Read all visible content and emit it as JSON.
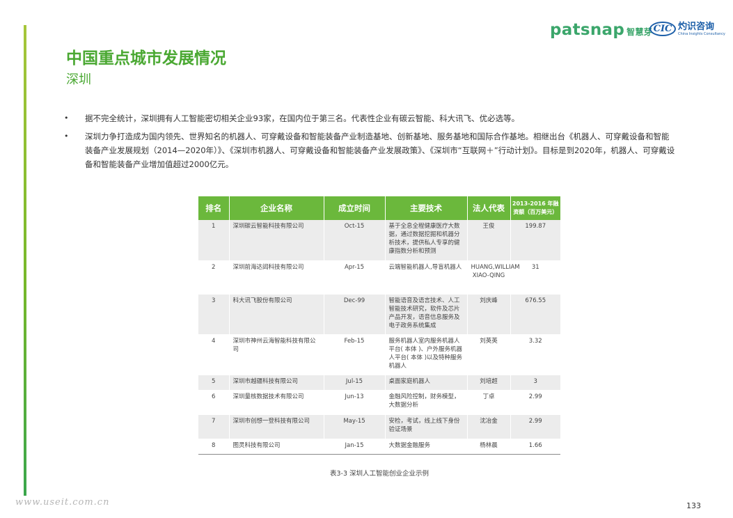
{
  "logos": {
    "patsnap": "patsnap",
    "patsnap_cn": "智慧芽",
    "cic_mark": "CIC",
    "cic_cn": "灼识咨询",
    "cic_en": "China Insights Consultancy"
  },
  "title": "中国重点城市发展情况",
  "subtitle": "深圳",
  "bullets": [
    "据不完全统计，深圳拥有人工智能密切相关企业93家，在国内位于第三名。代表性企业有碳云智能、科大讯飞、优必选等。",
    "深圳力争打造成为国内领先、世界知名的机器人、可穿戴设备和智能装备产业制造基地、创新基地、服务基地和国际合作基地。相继出台《机器人、可穿戴设备和智能装备产业发展规划（2014—2020年）》、《深圳市机器人、可穿戴设备和智能装备产业发展政策》、《深圳市“互联网＋”行动计划》。目标是到2020年，机器人、可穿戴设备和智能装备产业增加值超过2000亿元。"
  ],
  "table": {
    "headers": [
      "排名",
      "企业名称",
      "成立时间",
      "主要技术",
      "法人代表",
      "2013-2016 年融资额（百万美元）"
    ],
    "rows": [
      [
        "1",
        "深圳碳云智能科技有限公司",
        "Oct-15",
        "基于全息全程健康医疗大数据，通过数据挖掘和机器分析技术，提供私人专享的健康指数分析和预测",
        "王俊",
        "199.87"
      ],
      [
        "2",
        "深圳前海达闼科技有限公司",
        "Apr-15",
        "云端智能机器人,导盲机器人",
        "HUANG,WILLIAM XIAO-QING",
        "31"
      ],
      [
        "3",
        "科大讯飞股份有限公司",
        "Dec-99",
        "智能语音及语言技术、人工智能技术研究，软件及芯片产品开发，语音信息服务及电子政务系统集成",
        "刘庆峰",
        "676.55"
      ],
      [
        "4",
        "深圳市神州云海智能科技有限公司",
        "Feb-15",
        "服务机器人室内服务机器人平台( 本体 )、户外服务机器人平台( 本体 )以及特种服务机器人",
        "刘英英",
        "3.32"
      ],
      [
        "5",
        "深圳市越疆科技有限公司",
        "Jul-15",
        "桌面家庭机器人",
        "刘培超",
        "3"
      ],
      [
        "6",
        "深圳量核数据技术有限公司",
        "Jun-13",
        "金融风险控制，财务模型，大数据分析",
        "丁卓",
        "2.99"
      ],
      [
        "7",
        "深圳市创想一登科技有限公司",
        "May-15",
        "安检，考试，线上线下身份验证场景",
        "沈冶金",
        "2.99"
      ],
      [
        "8",
        "图灵科技有限公司",
        "Jan-15",
        "大数据金融服务",
        "杨林晨",
        "1.66"
      ]
    ]
  },
  "caption": "表3-3 深圳人工智能创业企业示例",
  "watermark": "www.useit.com.cn",
  "page_number": "133"
}
